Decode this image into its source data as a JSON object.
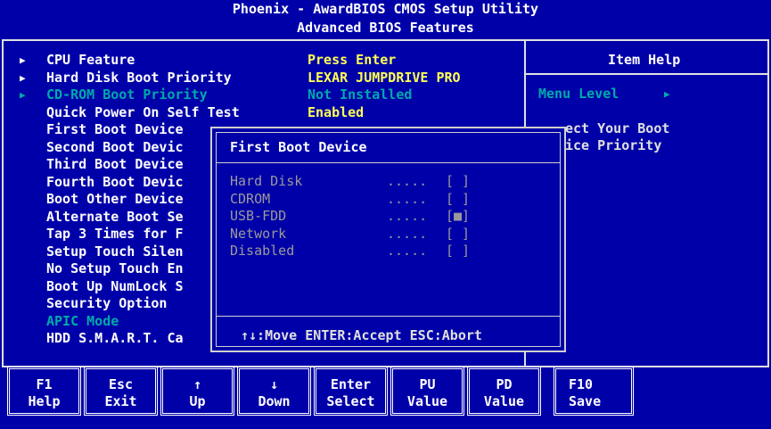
{
  "header": {
    "title": "Phoenix - AwardBIOS CMOS Setup Utility",
    "subtitle": "Advanced BIOS Features"
  },
  "menu": [
    {
      "marker": "▶",
      "label": "CPU Feature",
      "value": "Press Enter"
    },
    {
      "marker": "▶",
      "label": "Hard Disk Boot Priority",
      "value": "LEXAR JUMPDRIVE PRO"
    },
    {
      "marker": "▶",
      "label": "CD-ROM Boot Priority",
      "value": "Not Installed"
    },
    {
      "marker": "",
      "label": "Quick Power On Self Test",
      "value": "Enabled"
    },
    {
      "marker": "",
      "label": "First Boot Device",
      "value": ""
    },
    {
      "marker": "",
      "label": "Second Boot Devic",
      "value": ""
    },
    {
      "marker": "",
      "label": "Third Boot Device",
      "value": ""
    },
    {
      "marker": "",
      "label": "Fourth Boot Devic",
      "value": ""
    },
    {
      "marker": "",
      "label": "Boot Other Device",
      "value": ""
    },
    {
      "marker": "",
      "label": "Alternate Boot Se",
      "value": ""
    },
    {
      "marker": "",
      "label": "Tap 3 Times for F",
      "value": ""
    },
    {
      "marker": "",
      "label": "Setup Touch Silen",
      "value": ""
    },
    {
      "marker": "",
      "label": "No Setup Touch En",
      "value": ""
    },
    {
      "marker": "",
      "label": "Boot Up NumLock S",
      "value": ""
    },
    {
      "marker": "",
      "label": "Security Option",
      "value": ""
    },
    {
      "marker": "",
      "label": "APIC Mode",
      "value": ""
    },
    {
      "marker": "",
      "label": "HDD S.M.A.R.T. Ca",
      "value": ""
    }
  ],
  "item_help": {
    "title": "Item Help",
    "menu_level_label": "Menu Level",
    "menu_level_marker": "▶",
    "help_lines": [
      "ect Your Boot",
      "ice Priority"
    ]
  },
  "popup": {
    "title": "First Boot Device",
    "options": [
      {
        "label": "Hard Disk",
        "dots": ".....",
        "box": "[ ]"
      },
      {
        "label": "CDROM",
        "dots": ".....",
        "box": "[ ]"
      },
      {
        "label": "USB-FDD",
        "dots": ".....",
        "box": "[■]"
      },
      {
        "label": "Network",
        "dots": ".....",
        "box": "[ ]"
      },
      {
        "label": "Disabled",
        "dots": ".....",
        "box": "[ ]"
      }
    ],
    "hint": "↑↓:Move ENTER:Accept ESC:Abort"
  },
  "fkeys": [
    {
      "key": "F1",
      "action": "Help"
    },
    {
      "key": "Esc",
      "action": "Exit"
    },
    {
      "key": "↑",
      "action": "Up"
    },
    {
      "key": "↓",
      "action": "Down"
    },
    {
      "key": "Enter",
      "action": "Select"
    },
    {
      "key": "PU",
      "action": "Value"
    },
    {
      "key": "PD",
      "action": "Value"
    },
    {
      "key": "F10",
      "action": "Save"
    }
  ],
  "colors": {
    "background": "#0000a8",
    "text": "#ffffff",
    "value_highlight": "#ffff55",
    "selected": "#00aaaa",
    "disabled_option": "#9a9a9a"
  }
}
